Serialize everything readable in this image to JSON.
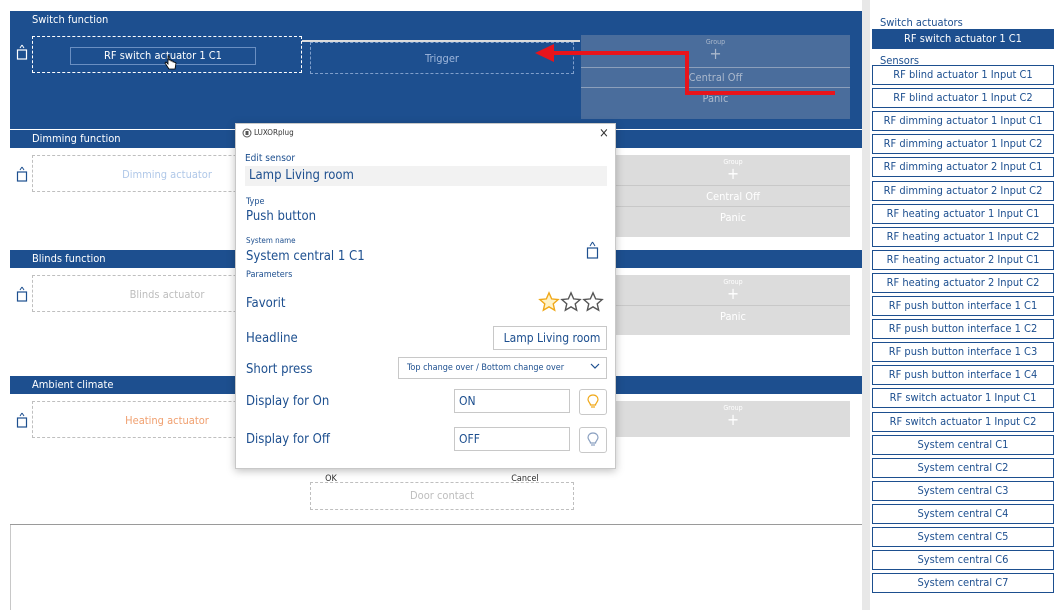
{
  "sections": {
    "switch": {
      "title": "Switch function",
      "actuator": "RF switch actuator 1 C1",
      "trigger": "Trigger",
      "group": "Group",
      "plus": "+",
      "central_off": "Central Off",
      "panic": "Panic"
    },
    "dimming": {
      "title": "Dimming function",
      "actuator": "Dimming actuator",
      "group": "Group",
      "plus": "+",
      "central_off": "Central Off",
      "panic": "Panic"
    },
    "blinds": {
      "title": "Blinds function",
      "actuator": "Blinds actuator",
      "group": "Group",
      "plus": "+",
      "panic": "Panic"
    },
    "ambient": {
      "title": "Ambient climate",
      "actuator": "Heating actuator",
      "group": "Group",
      "plus": "+",
      "door_contact": "Door contact"
    }
  },
  "dialog": {
    "app_title": "LUXORplug",
    "close": "×",
    "edit_sensor_label": "Edit sensor",
    "edit_sensor_value": "Lamp Living room",
    "type_label": "Type",
    "type_value": "Push button",
    "system_name_label": "System name",
    "system_name_value": "System central 1 C1",
    "parameters_label": "Parameters",
    "favorit_label": "Favorit",
    "favorit_rating": 1,
    "favorit_max": 3,
    "headline_label": "Headline",
    "headline_value": "Lamp Living room",
    "short_press_label": "Short press",
    "short_press_value": "Top change over / Bottom change over",
    "display_on_label": "Display for On",
    "display_on_value": "ON",
    "display_off_label": "Display for Off",
    "display_off_value": "OFF",
    "ok": "OK",
    "cancel": "Cancel"
  },
  "right_panel": {
    "switch_actuators_label": "Switch actuators",
    "sensors_label": "Sensors",
    "switch_actuators": [
      "RF switch actuator 1 C1"
    ],
    "sensors": [
      "RF blind actuator 1 Input C1",
      "RF blind actuator 1 Input C2",
      "RF dimming actuator 1 Input C1",
      "RF dimming actuator 1 Input C2",
      "RF dimming actuator 2 Input C1",
      "RF dimming actuator 2 Input C2",
      "RF heating actuator 1 Input C1",
      "RF heating actuator 1 Input C2",
      "RF heating actuator 2 Input C1",
      "RF heating actuator 2 Input C2",
      "RF push button interface 1 C1",
      "RF push button interface 1 C2",
      "RF push button interface 1 C3",
      "RF push button interface 1 C4",
      "RF switch actuator 1 Input C1",
      "RF switch actuator 1 Input C2",
      "System central C1",
      "System central C2",
      "System central C3",
      "System central C4",
      "System central C5",
      "System central C6",
      "System central C7"
    ]
  },
  "colors": {
    "primary_blue": "#1d4f8f",
    "arrow_red": "#e8141b",
    "star_gold": "#f0a818",
    "orange_text": "#f0a070"
  }
}
